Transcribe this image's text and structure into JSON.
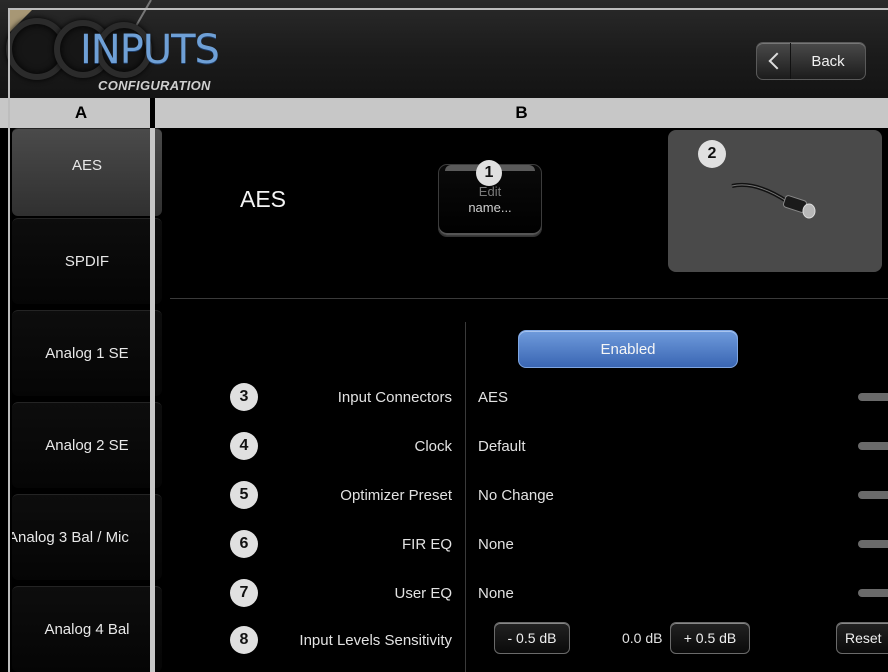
{
  "header": {
    "title": "INPUTS",
    "subtitle": "CONFIGURATION",
    "back_label": "Back"
  },
  "columns": {
    "a": "A",
    "b": "B"
  },
  "sidebar": {
    "items": [
      {
        "label": "AES",
        "active": true
      },
      {
        "label": "SPDIF"
      },
      {
        "label": "Analog 1 SE"
      },
      {
        "label": "Analog 2 SE"
      },
      {
        "label": "Analog 3 Bal / Mic"
      },
      {
        "label": "Analog 4 Bal"
      }
    ]
  },
  "main": {
    "heading": "AES",
    "edit_name_line1": "Edit",
    "edit_name_line2": "name...",
    "enabled_label": "Enabled",
    "badges": {
      "b1": "1",
      "b2": "2",
      "b3": "3",
      "b4": "4",
      "b5": "5",
      "b6": "6",
      "b7": "7",
      "b8": "8"
    },
    "settings": [
      {
        "label": "Input Connectors",
        "value": "AES"
      },
      {
        "label": "Clock",
        "value": "Default"
      },
      {
        "label": "Optimizer Preset",
        "value": "No Change"
      },
      {
        "label": "FIR EQ",
        "value": "None"
      },
      {
        "label": "User EQ",
        "value": "None"
      }
    ],
    "input_levels": {
      "label": "Input Levels Sensitivity",
      "decrease_label": "- 0.5 dB",
      "value": "0.0 dB",
      "increase_label": "+ 0.5 dB",
      "reset_label": "Reset"
    }
  },
  "colors": {
    "accent_blue": "#4a76c2",
    "title_blue": "#6fa0d6",
    "panel_gray": "#4a4a4a"
  }
}
